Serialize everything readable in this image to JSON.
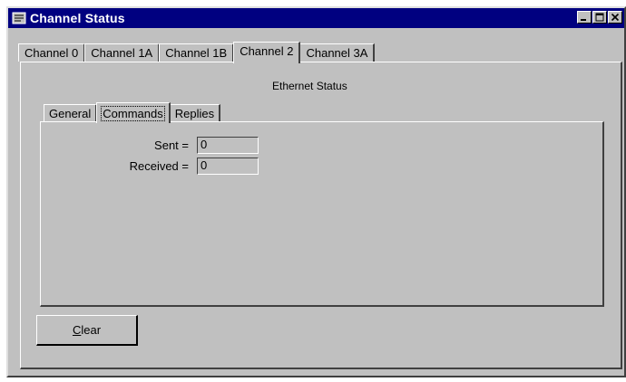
{
  "window": {
    "title": "Channel Status"
  },
  "tabs": [
    {
      "label": "Channel 0"
    },
    {
      "label": "Channel 1A"
    },
    {
      "label": "Channel 1B"
    },
    {
      "label": "Channel 2",
      "active": true
    },
    {
      "label": "Channel 3A"
    }
  ],
  "panel": {
    "heading": "Ethernet Status"
  },
  "subtabs": [
    {
      "label": "General"
    },
    {
      "label": "Commands",
      "active": true
    },
    {
      "label": "Replies"
    }
  ],
  "fields": {
    "sent_label": "Sent =",
    "sent_value": "0",
    "received_label": "Received =",
    "received_value": "0"
  },
  "buttons": {
    "clear_mnemonic": "C",
    "clear_rest": "lear"
  },
  "colors": {
    "titlebar": "#000080",
    "face": "#c0c0c0"
  }
}
